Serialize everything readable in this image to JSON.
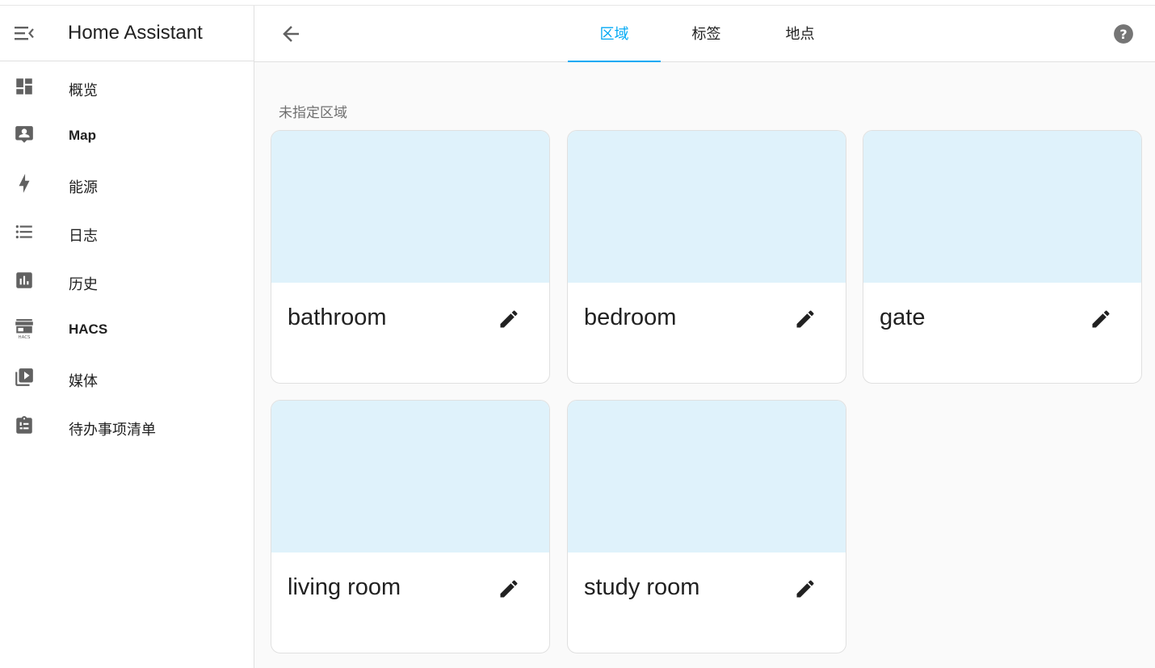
{
  "app": {
    "title": "Home Assistant"
  },
  "sidebar": {
    "items": [
      {
        "label": "概览",
        "icon": "dashboard-icon"
      },
      {
        "label": "Map",
        "icon": "map-account-icon"
      },
      {
        "label": "能源",
        "icon": "lightning-bolt-icon"
      },
      {
        "label": "日志",
        "icon": "format-list-bulleted-icon"
      },
      {
        "label": "历史",
        "icon": "chart-box-icon"
      },
      {
        "label": "HACS",
        "icon": "hacs-store-icon"
      },
      {
        "label": "媒体",
        "icon": "play-box-multiple-icon"
      },
      {
        "label": "待办事项清单",
        "icon": "clipboard-list-icon"
      }
    ]
  },
  "topbar": {
    "tabs": [
      {
        "label": "区域",
        "active": true
      },
      {
        "label": "标签",
        "active": false
      },
      {
        "label": "地点",
        "active": false
      }
    ]
  },
  "main": {
    "section_title": "未指定区域",
    "areas": [
      {
        "name": "bathroom"
      },
      {
        "name": "bedroom"
      },
      {
        "name": "gate"
      },
      {
        "name": "living room"
      },
      {
        "name": "study room"
      }
    ]
  },
  "colors": {
    "accent": "#03a9f4",
    "card_image": "#dff2fb",
    "icon": "#616161"
  }
}
